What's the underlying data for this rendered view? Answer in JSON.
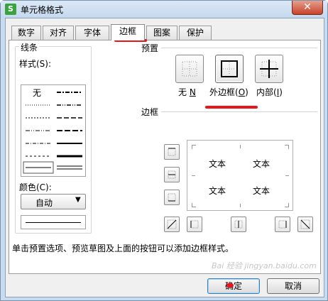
{
  "window": {
    "app_icon": "S",
    "title": "单元格格式",
    "close_glyph": "✕"
  },
  "tabs": [
    "数字",
    "对齐",
    "字体",
    "边框",
    "图案",
    "保护"
  ],
  "active_tab": "边框",
  "line_group": {
    "title": "线条",
    "style_label": "样式(S):",
    "none_label": "无",
    "color_label": "颜色(C):",
    "color_value": "自动",
    "dropdown_arrow": "▼"
  },
  "presets": {
    "title": "预置",
    "items": [
      {
        "name": "无",
        "key": "N"
      },
      {
        "name": "外边框",
        "key": "O"
      },
      {
        "name": "内部",
        "key": "I"
      }
    ]
  },
  "border": {
    "title": "边框",
    "preview_texts": [
      "文本",
      "文本",
      "文本",
      "文本"
    ]
  },
  "hint": "单击预置选项、预览草图及上面的按钮可以添加边框样式。",
  "buttons": {
    "ok": "确定",
    "cancel": "取消"
  },
  "watermark": "Bai 经验  jingyan.baidu.com",
  "colors": {
    "annotation": "#e8151a",
    "title_bar": "#c9dcef",
    "close": "#c7432a"
  }
}
